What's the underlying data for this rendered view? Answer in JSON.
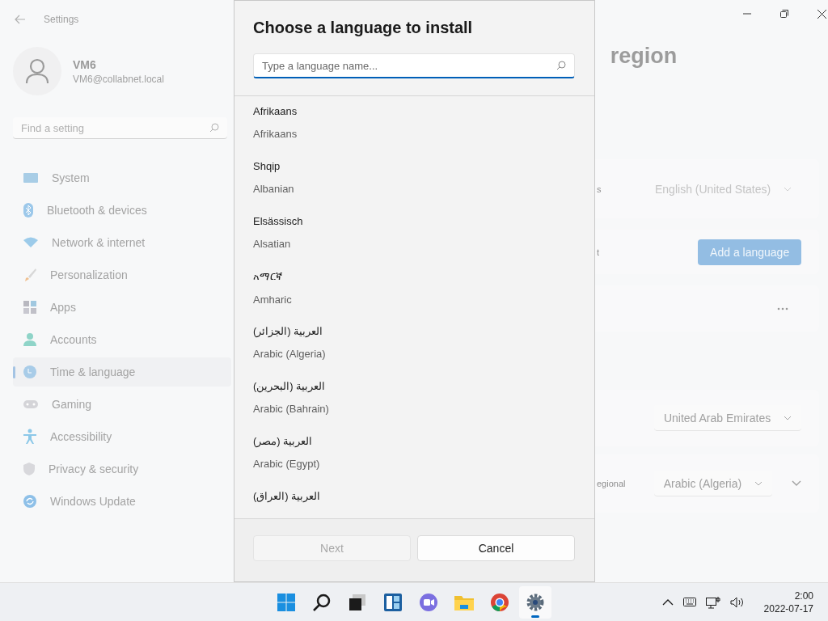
{
  "window": {
    "title": "Settings"
  },
  "account": {
    "name": "VM6",
    "email": "VM6@collabnet.local"
  },
  "search": {
    "placeholder": "Find a setting"
  },
  "sidebar": {
    "items": [
      {
        "label": "System",
        "selected": false
      },
      {
        "label": "Bluetooth & devices",
        "selected": false
      },
      {
        "label": "Network & internet",
        "selected": false
      },
      {
        "label": "Personalization",
        "selected": false
      },
      {
        "label": "Apps",
        "selected": false
      },
      {
        "label": "Accounts",
        "selected": false
      },
      {
        "label": "Time & language",
        "selected": true
      },
      {
        "label": "Gaming",
        "selected": false
      },
      {
        "label": "Accessibility",
        "selected": false
      },
      {
        "label": "Privacy & security",
        "selected": false
      },
      {
        "label": "Windows Update",
        "selected": false
      }
    ]
  },
  "page": {
    "title": "region",
    "rows": [
      {
        "kind": "dropdown",
        "label": "s",
        "value": "English (United States)",
        "disabled": true
      },
      {
        "kind": "button",
        "label": "t",
        "value": "Add a language"
      },
      {
        "kind": "more"
      },
      {
        "kind": "dropdown",
        "value": "United Arab Emirates",
        "disabled": false
      },
      {
        "kind": "dropdown",
        "label": "egional",
        "value": "Arabic (Algeria)",
        "disabled": false,
        "expandable": true
      }
    ]
  },
  "dialog": {
    "title": "Choose a language to install",
    "search": {
      "placeholder": "Type a language name..."
    },
    "languages": [
      {
        "native": "Afrikaans",
        "english": "Afrikaans"
      },
      {
        "native": "Shqip",
        "english": "Albanian"
      },
      {
        "native": "Elsässisch",
        "english": "Alsatian"
      },
      {
        "native": "አማርኛ",
        "english": "Amharic"
      },
      {
        "native": "العربية (الجزائر)",
        "english": "Arabic (Algeria)"
      },
      {
        "native": "العربية (البحرين)",
        "english": "Arabic (Bahrain)"
      },
      {
        "native": "العربية (مصر)",
        "english": "Arabic (Egypt)"
      },
      {
        "native": "العربية (العراق)"
      }
    ],
    "buttons": [
      {
        "label": "Next",
        "disabled": true
      },
      {
        "label": "Cancel",
        "disabled": false
      }
    ]
  },
  "taskbar": {
    "apps": [
      {
        "selected": false
      },
      {
        "selected": false
      },
      {
        "selected": false
      },
      {
        "selected": false
      },
      {
        "selected": false
      },
      {
        "selected": false
      },
      {
        "selected": false
      },
      {
        "selected": true
      }
    ],
    "time": "2:00",
    "date": "2022-07-17"
  }
}
